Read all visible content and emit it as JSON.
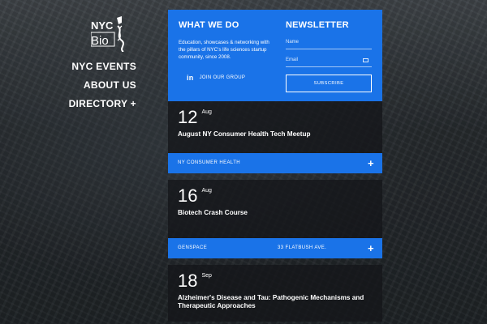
{
  "logo": {
    "line1": "NYC",
    "line2": "Bio"
  },
  "nav": {
    "events": "NYC EVENTS",
    "about": "ABOUT US",
    "directory": "DIRECTORY +"
  },
  "what_we_do": {
    "heading": "WHAT WE DO",
    "description": "Education, showcases & networking with the pillars of NYC's life sciences startup community, since 2008.",
    "join_icon": "in",
    "join_label": "JOIN OUR GROUP"
  },
  "newsletter": {
    "heading": "NEWSLETTER",
    "name_placeholder": "Name",
    "email_placeholder": "Email",
    "subscribe_label": "SUBSCRIBE"
  },
  "events": [
    {
      "day": "12",
      "month": "Aug",
      "title": "August NY Consumer Health Tech Meetup",
      "host": "NY CONSUMER HEALTH",
      "location": ""
    },
    {
      "day": "16",
      "month": "Aug",
      "title": "Biotech Crash Course",
      "host": "GENSPACE",
      "location": "33 FLATBUSH AVE."
    },
    {
      "day": "18",
      "month": "Sep",
      "title": "Alzheimer's Disease and Tau: Pathogenic Mechanisms and Therapeutic Approaches",
      "host": "",
      "location": ""
    }
  ],
  "colors": {
    "accent": "#1a73e8",
    "card": "#14161a"
  }
}
